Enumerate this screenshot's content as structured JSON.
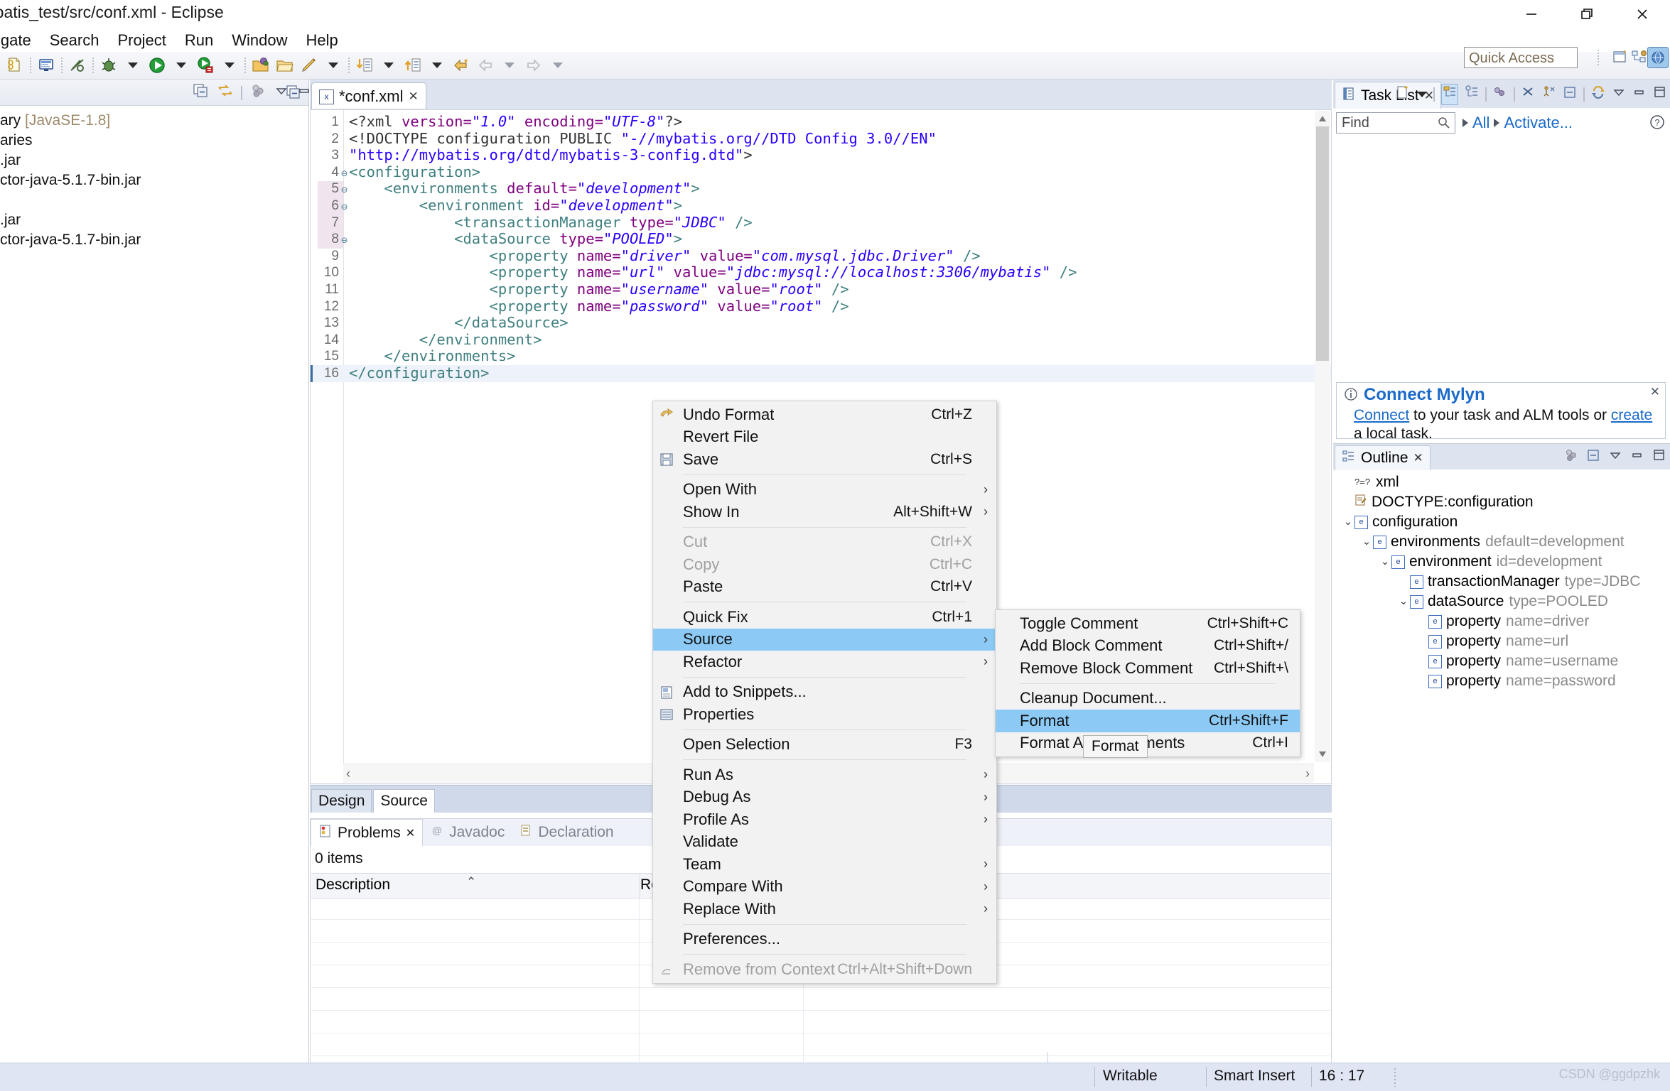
{
  "window": {
    "title": "mybatis_test/src/conf.xml - Eclipse",
    "minimize_label": "minimize-icon",
    "maximize_label": "restore-icon",
    "close_label": "close-icon"
  },
  "menubar": {
    "items": [
      "igate",
      "Search",
      "Project",
      "Run",
      "Window",
      "Help"
    ]
  },
  "toolbar": {
    "quick_access_placeholder": "Quick Access"
  },
  "package_explorer": {
    "rows": [
      {
        "text": "ary ",
        "attr": "[JavaSE-1.8]"
      },
      {
        "text": "aries",
        "attr": ""
      },
      {
        "text": ".jar",
        "attr": ""
      },
      {
        "text": "ctor-java-5.1.7-bin.jar",
        "attr": ""
      },
      {
        "text": "",
        "attr": ""
      },
      {
        "text": ".jar",
        "attr": ""
      },
      {
        "text": "ctor-java-5.1.7-bin.jar",
        "attr": ""
      }
    ]
  },
  "editor": {
    "tab_label": "*conf.xml",
    "tab_close": "✕",
    "tab_badge": "x",
    "lines": [
      {
        "n": "1",
        "fold": "",
        "cur": false,
        "html": "<span class='d'>&lt;?xml </span><span class='a'>version=</span><span class='v'>\"1.0\"</span><span class='a'> encoding=</span><span class='v'>\"UTF-8\"</span><span class='d'>?&gt;</span>"
      },
      {
        "n": "2",
        "fold": "",
        "cur": false,
        "html": "<span class='d'>&lt;!DOCTYPE configuration PUBLIC </span><span class='q'>\"-//mybatis.org//DTD Config 3.0//EN\"</span>"
      },
      {
        "n": "3",
        "fold": "",
        "cur": false,
        "html": "<span class='q'>\"http://mybatis.org/dtd/mybatis-3-config.dtd\"</span><span class='d'>&gt;</span>"
      },
      {
        "n": "4",
        "fold": "⊖",
        "cur": false,
        "html": "<span class='t'>&lt;configuration&gt;</span>"
      },
      {
        "n": "5",
        "fold": "⊖",
        "cur": false,
        "html": "    <span class='t'>&lt;environments </span><span class='a'>default=</span><span class='v'>\"development\"</span><span class='t'>&gt;</span>"
      },
      {
        "n": "6",
        "fold": "⊖",
        "cur": false,
        "html": "        <span class='t'>&lt;environment </span><span class='a'>id=</span><span class='v'>\"development\"</span><span class='t'>&gt;</span>"
      },
      {
        "n": "7",
        "fold": "",
        "cur": false,
        "html": "            <span class='t'>&lt;transactionManager </span><span class='a'>type=</span><span class='v'>\"JDBC\"</span><span class='t'> /&gt;</span>"
      },
      {
        "n": "8",
        "fold": "⊖",
        "cur": false,
        "html": "            <span class='t'>&lt;dataSource </span><span class='a'>type=</span><span class='v'>\"POOLED\"</span><span class='t'>&gt;</span>"
      },
      {
        "n": "9",
        "fold": "",
        "cur": false,
        "html": "                <span class='t'>&lt;property </span><span class='a'>name=</span><span class='v'>\"driver\"</span><span class='a'> value=</span><span class='v'>\"com.mysql.jdbc.Driver\"</span><span class='t'> /&gt;</span>"
      },
      {
        "n": "10",
        "fold": "",
        "cur": false,
        "html": "                <span class='t'>&lt;property </span><span class='a'>name=</span><span class='v'>\"url\"</span><span class='a'> value=</span><span class='v'>\"jdbc:mysql://localhost:3306/mybatis\"</span><span class='t'> /&gt;</span>"
      },
      {
        "n": "11",
        "fold": "",
        "cur": false,
        "html": "                <span class='t'>&lt;property </span><span class='a'>name=</span><span class='v'>\"username\"</span><span class='a'> value=</span><span class='v'>\"root\"</span><span class='t'> /&gt;</span>"
      },
      {
        "n": "12",
        "fold": "",
        "cur": false,
        "html": "                <span class='t'>&lt;property </span><span class='a'>name=</span><span class='v'>\"password\"</span><span class='a'> value=</span><span class='v'>\"root\"</span><span class='t'> /&gt;</span>"
      },
      {
        "n": "13",
        "fold": "",
        "cur": false,
        "html": "            <span class='t'>&lt;/dataSource&gt;</span>"
      },
      {
        "n": "14",
        "fold": "",
        "cur": false,
        "html": "        <span class='t'>&lt;/environment&gt;</span>"
      },
      {
        "n": "15",
        "fold": "",
        "cur": false,
        "html": "    <span class='t'>&lt;/environments&gt;</span>"
      },
      {
        "n": "16",
        "fold": "",
        "cur": true,
        "html": "<span class='t'>&lt;/configuration&gt;</span>"
      }
    ],
    "design_source_tabs": [
      {
        "label": "Design",
        "active": false
      },
      {
        "label": "Source",
        "active": true
      }
    ]
  },
  "problems_view": {
    "tabs": [
      {
        "label": "Problems",
        "active": true,
        "icon": "problems-icon",
        "close": "✕"
      },
      {
        "label": "Javadoc",
        "active": false,
        "icon": "javadoc-icon",
        "close": ""
      },
      {
        "label": "Declaration",
        "active": false,
        "icon": "declaration-icon",
        "close": ""
      }
    ],
    "items_count": "0 items",
    "columns": [
      "Description",
      "Re"
    ]
  },
  "task_list": {
    "tab_label": "Task List",
    "tab_close": "✕",
    "find_placeholder": "Find",
    "links": [
      "All",
      "Activate..."
    ],
    "help_icon": "help-icon"
  },
  "mylyn": {
    "title": "Connect Mylyn",
    "body_prefix": "",
    "link1": "Connect",
    "mid": " to your task and ALM tools or ",
    "link2": "create",
    "suffix": " a local task.",
    "close": "✕"
  },
  "outline": {
    "tab_label": "Outline",
    "tab_close": "✕",
    "rows": [
      {
        "indent": 0,
        "arrow": "",
        "badge": "?=?",
        "label": "xml",
        "attr": "",
        "badge_kind": "pi"
      },
      {
        "indent": 0,
        "arrow": "",
        "badge": "dt",
        "label": "DOCTYPE:configuration",
        "attr": "",
        "badge_kind": "doctype"
      },
      {
        "indent": 0,
        "arrow": "v",
        "badge": "e",
        "label": "configuration",
        "attr": "",
        "badge_kind": "el"
      },
      {
        "indent": 1,
        "arrow": "v",
        "badge": "e",
        "label": "environments",
        "attr": "default=development",
        "badge_kind": "el"
      },
      {
        "indent": 2,
        "arrow": "v",
        "badge": "e",
        "label": "environment",
        "attr": "id=development",
        "badge_kind": "el"
      },
      {
        "indent": 3,
        "arrow": "",
        "badge": "e",
        "label": "transactionManager",
        "attr": "type=JDBC",
        "badge_kind": "el"
      },
      {
        "indent": 3,
        "arrow": "v",
        "badge": "e",
        "label": "dataSource",
        "attr": "type=POOLED",
        "badge_kind": "el"
      },
      {
        "indent": 4,
        "arrow": "",
        "badge": "e",
        "label": "property",
        "attr": "name=driver",
        "badge_kind": "el"
      },
      {
        "indent": 4,
        "arrow": "",
        "badge": "e",
        "label": "property",
        "attr": "name=url",
        "badge_kind": "el"
      },
      {
        "indent": 4,
        "arrow": "",
        "badge": "e",
        "label": "property",
        "attr": "name=username",
        "badge_kind": "el"
      },
      {
        "indent": 4,
        "arrow": "",
        "badge": "e",
        "label": "property",
        "attr": "name=password",
        "badge_kind": "el"
      }
    ]
  },
  "context_menu": {
    "items": [
      {
        "kind": "item",
        "label": "Undo Format",
        "accel": "Ctrl+Z",
        "icon": "undo-icon",
        "disabled": false,
        "submenu": false,
        "selected": false
      },
      {
        "kind": "item",
        "label": "Revert File",
        "accel": "",
        "icon": "",
        "disabled": false,
        "submenu": false,
        "selected": false
      },
      {
        "kind": "item",
        "label": "Save",
        "accel": "Ctrl+S",
        "icon": "save-icon",
        "disabled": false,
        "submenu": false,
        "selected": false
      },
      {
        "kind": "sep"
      },
      {
        "kind": "item",
        "label": "Open With",
        "accel": "",
        "icon": "",
        "disabled": false,
        "submenu": true,
        "selected": false
      },
      {
        "kind": "item",
        "label": "Show In",
        "accel": "Alt+Shift+W",
        "icon": "",
        "disabled": false,
        "submenu": true,
        "selected": false
      },
      {
        "kind": "sep"
      },
      {
        "kind": "item",
        "label": "Cut",
        "accel": "Ctrl+X",
        "icon": "",
        "disabled": true,
        "submenu": false,
        "selected": false
      },
      {
        "kind": "item",
        "label": "Copy",
        "accel": "Ctrl+C",
        "icon": "",
        "disabled": true,
        "submenu": false,
        "selected": false
      },
      {
        "kind": "item",
        "label": "Paste",
        "accel": "Ctrl+V",
        "icon": "",
        "disabled": false,
        "submenu": false,
        "selected": false
      },
      {
        "kind": "sep"
      },
      {
        "kind": "item",
        "label": "Quick Fix",
        "accel": "Ctrl+1",
        "icon": "",
        "disabled": false,
        "submenu": false,
        "selected": false
      },
      {
        "kind": "item",
        "label": "Source",
        "accel": "",
        "icon": "",
        "disabled": false,
        "submenu": true,
        "selected": true
      },
      {
        "kind": "item",
        "label": "Refactor",
        "accel": "",
        "icon": "",
        "disabled": false,
        "submenu": true,
        "selected": false
      },
      {
        "kind": "sep"
      },
      {
        "kind": "item",
        "label": "Add to Snippets...",
        "accel": "",
        "icon": "snippets-icon",
        "disabled": false,
        "submenu": false,
        "selected": false
      },
      {
        "kind": "item",
        "label": "Properties",
        "accel": "",
        "icon": "properties-icon",
        "disabled": false,
        "submenu": false,
        "selected": false
      },
      {
        "kind": "sep"
      },
      {
        "kind": "item",
        "label": "Open Selection",
        "accel": "F3",
        "icon": "",
        "disabled": false,
        "submenu": false,
        "selected": false
      },
      {
        "kind": "sep"
      },
      {
        "kind": "item",
        "label": "Run As",
        "accel": "",
        "icon": "",
        "disabled": false,
        "submenu": true,
        "selected": false
      },
      {
        "kind": "item",
        "label": "Debug As",
        "accel": "",
        "icon": "",
        "disabled": false,
        "submenu": true,
        "selected": false
      },
      {
        "kind": "item",
        "label": "Profile As",
        "accel": "",
        "icon": "",
        "disabled": false,
        "submenu": true,
        "selected": false
      },
      {
        "kind": "item",
        "label": "Validate",
        "accel": "",
        "icon": "",
        "disabled": false,
        "submenu": false,
        "selected": false
      },
      {
        "kind": "item",
        "label": "Team",
        "accel": "",
        "icon": "",
        "disabled": false,
        "submenu": true,
        "selected": false
      },
      {
        "kind": "item",
        "label": "Compare With",
        "accel": "",
        "icon": "",
        "disabled": false,
        "submenu": true,
        "selected": false
      },
      {
        "kind": "item",
        "label": "Replace With",
        "accel": "",
        "icon": "",
        "disabled": false,
        "submenu": true,
        "selected": false
      },
      {
        "kind": "sep"
      },
      {
        "kind": "item",
        "label": "Preferences...",
        "accel": "",
        "icon": "",
        "disabled": false,
        "submenu": false,
        "selected": false
      },
      {
        "kind": "sep"
      },
      {
        "kind": "item",
        "label": "Remove from Context",
        "accel": "Ctrl+Alt+Shift+Down",
        "icon": "remove-context-icon",
        "disabled": true,
        "submenu": false,
        "selected": false
      }
    ]
  },
  "source_submenu": {
    "items": [
      {
        "kind": "item",
        "label": "Toggle Comment",
        "accel": "Ctrl+Shift+C",
        "selected": false
      },
      {
        "kind": "item",
        "label": "Add Block Comment",
        "accel": "Ctrl+Shift+/",
        "selected": false
      },
      {
        "kind": "item",
        "label": "Remove Block Comment",
        "accel": "Ctrl+Shift+\\",
        "selected": false
      },
      {
        "kind": "sep"
      },
      {
        "kind": "item",
        "label": "Cleanup Document...",
        "accel": "",
        "selected": false
      },
      {
        "kind": "item",
        "label": "Format",
        "accel": "Ctrl+Shift+F",
        "selected": true
      },
      {
        "kind": "item",
        "label": "Format Active Elements",
        "accel": "Ctrl+I",
        "selected": false
      }
    ]
  },
  "tooltip": {
    "text": "Format"
  },
  "statusbar": {
    "writable": "Writable",
    "insert_mode": "Smart Insert",
    "position": "16 : 17",
    "watermark": "CSDN @ggdpzhk"
  },
  "colors": {
    "selection_blue": "#8ccaf5",
    "link_blue": "#1b6ac9",
    "tag_teal": "#3f7f7f",
    "attr_purple": "#7f007f",
    "value_blue": "#2a00ff",
    "statusbar_bg": "#dfe5f3"
  }
}
